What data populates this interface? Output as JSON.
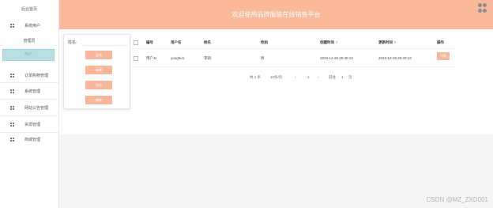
{
  "sidebar": {
    "home": "后台首页",
    "items": [
      {
        "label": "系统用户"
      },
      {
        "label": "订单购物管理"
      },
      {
        "label": "系统管理"
      },
      {
        "label": "网站公告管理"
      },
      {
        "label": "资源管理"
      },
      {
        "label": "商城管理"
      }
    ],
    "sub_label": "管理员",
    "active_label": "用户"
  },
  "header": {
    "title": "欢迎使用品牌服装在线销售平台"
  },
  "search_panel": {
    "label": "姓名:",
    "buttons": [
      "查询",
      "新增",
      "导出",
      "删除"
    ]
  },
  "table": {
    "headers": [
      "编号",
      "用户名",
      "姓名",
      "性别",
      "创建时间",
      "更新时间",
      "操作"
    ],
    "sort_mark": "⇕",
    "rows": [
      {
        "id": "用户11",
        "username": "yonghu1",
        "name": "李四",
        "gender": "男",
        "created": "2023-12-26 20:40:13",
        "updated": "2023-12-26 20:40:13",
        "action": "详情"
      }
    ]
  },
  "pagination": {
    "total": "共 1 条",
    "page_size": "10条/页",
    "prev": "‹",
    "current": "1",
    "next": "›",
    "goto_label": "前往",
    "goto_value": "1",
    "page_suffix": "页"
  },
  "watermark": "CSDN @MZ_ZXD001",
  "colors": {
    "header": "#fbb99b",
    "button": "#f8b69b",
    "active_item": "#b7dfe4"
  }
}
